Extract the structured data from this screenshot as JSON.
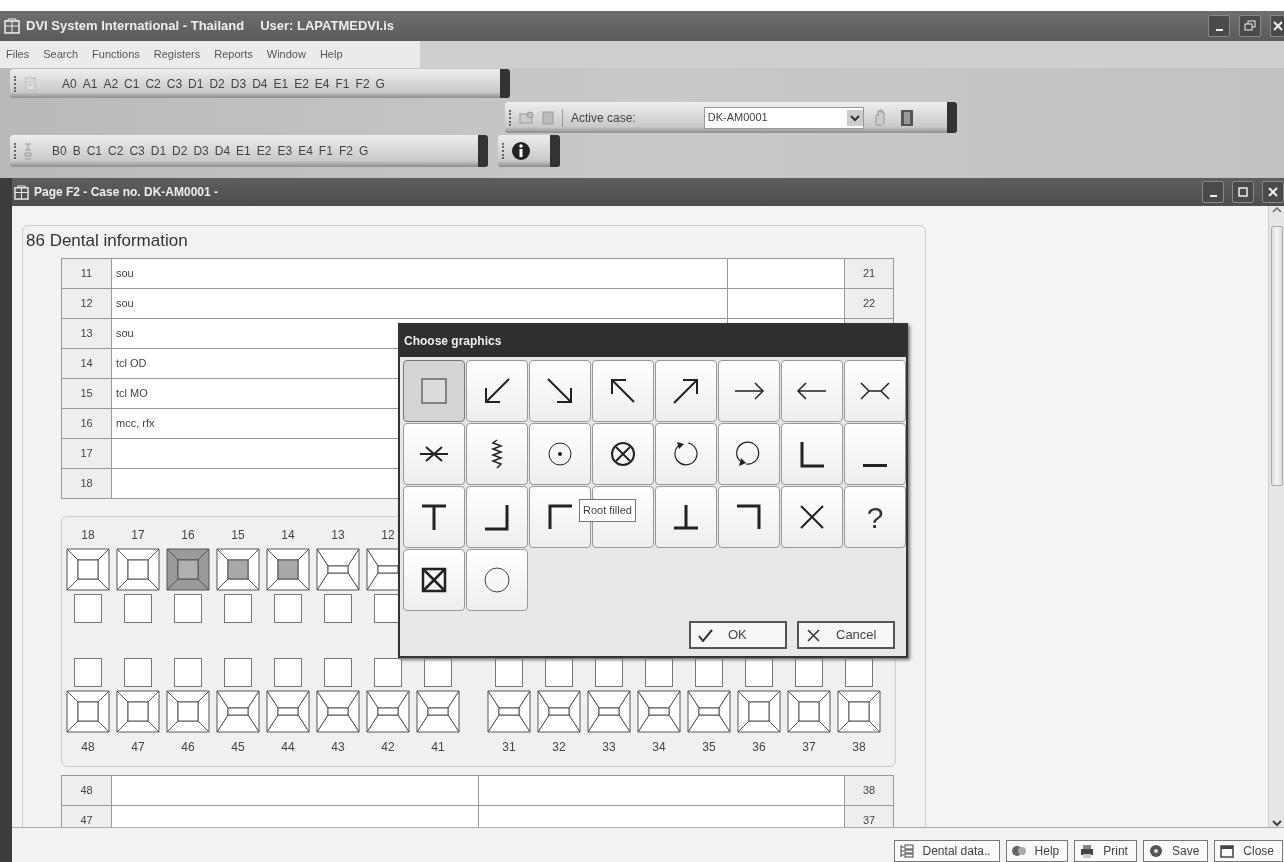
{
  "app": {
    "title": "DVI System International - Thailand",
    "user": "User: LAPATMEDVI.is"
  },
  "menu": [
    {
      "label": "Files"
    },
    {
      "label": "Search"
    },
    {
      "label": "Functions"
    },
    {
      "label": "Registers"
    },
    {
      "label": "Reports"
    },
    {
      "label": "Window"
    },
    {
      "label": "Help"
    }
  ],
  "toolbar_a": {
    "buttons": [
      "A0",
      "A1",
      "A2",
      "C1",
      "C2",
      "C3",
      "D1",
      "D2",
      "D3",
      "D4",
      "E1",
      "E2",
      "E4",
      "F1",
      "F2",
      "G"
    ]
  },
  "case_toolbar": {
    "label": "Active case:",
    "value": "DK-AM0001"
  },
  "toolbar_b": {
    "buttons": [
      "B0",
      "B",
      "C1",
      "C2",
      "C3",
      "D1",
      "D2",
      "D3",
      "D4",
      "E1",
      "E2",
      "E3",
      "E4",
      "F1",
      "F2",
      "G"
    ]
  },
  "page": {
    "title": "Page F2 - Case no. DK-AM0001 -",
    "section": "86 Dental information",
    "upper_table": [
      {
        "tooth": "11",
        "finding": "sou",
        "opposite": "21"
      },
      {
        "tooth": "12",
        "finding": "sou",
        "opposite": "22"
      },
      {
        "tooth": "13",
        "finding": "sou"
      },
      {
        "tooth": "14",
        "finding": "tcl OD"
      },
      {
        "tooth": "15",
        "finding": "tcl MO"
      },
      {
        "tooth": "16",
        "finding": "mcc, rfx"
      },
      {
        "tooth": "17"
      },
      {
        "tooth": "18"
      }
    ],
    "chart": {
      "upper": [
        {
          "number": "18",
          "kind": "molar",
          "filled": false,
          "center_filled": false
        },
        {
          "number": "17",
          "kind": "molar",
          "filled": false,
          "center_filled": false
        },
        {
          "number": "16",
          "kind": "molar",
          "filled": true,
          "center_filled": true
        },
        {
          "number": "15",
          "kind": "molar",
          "filled": false,
          "center_filled": true
        },
        {
          "number": "14",
          "kind": "molar",
          "filled": false,
          "center_filled": true
        },
        {
          "number": "13",
          "kind": "front",
          "filled": false,
          "center_filled": false
        },
        {
          "number": "12",
          "kind": "front",
          "filled": false,
          "center_filled": false
        }
      ],
      "lower": [
        {
          "number": "48",
          "kind": "molar",
          "filled": false,
          "center_filled": false
        },
        {
          "number": "47",
          "kind": "molar",
          "filled": false,
          "center_filled": false
        },
        {
          "number": "46",
          "kind": "molar",
          "filled": false,
          "center_filled": false
        },
        {
          "number": "45",
          "kind": "front",
          "filled": false,
          "center_filled": false
        },
        {
          "number": "44",
          "kind": "front",
          "filled": false,
          "center_filled": false
        },
        {
          "number": "43",
          "kind": "front",
          "filled": false,
          "center_filled": false
        },
        {
          "number": "42",
          "kind": "front",
          "filled": false,
          "center_filled": false
        },
        {
          "number": "41",
          "kind": "front",
          "filled": false,
          "center_filled": false
        },
        {
          "number": "31",
          "kind": "front",
          "filled": false,
          "center_filled": false
        },
        {
          "number": "32",
          "kind": "front",
          "filled": false,
          "center_filled": false
        },
        {
          "number": "33",
          "kind": "front",
          "filled": false,
          "center_filled": false
        },
        {
          "number": "34",
          "kind": "front",
          "filled": false,
          "center_filled": false
        },
        {
          "number": "35",
          "kind": "front",
          "filled": false,
          "center_filled": false
        },
        {
          "number": "36",
          "kind": "molar",
          "filled": false,
          "center_filled": false
        },
        {
          "number": "37",
          "kind": "molar",
          "filled": false,
          "center_filled": false
        },
        {
          "number": "38",
          "kind": "molar",
          "filled": false,
          "center_filled": false
        }
      ]
    },
    "lower_table": [
      {
        "tooth": "48",
        "opposite": "38"
      },
      {
        "tooth": "47",
        "opposite": "37"
      }
    ]
  },
  "dialog": {
    "title": "Choose graphics",
    "tooltip": "Root filled",
    "symbols": [
      {
        "kind": "square",
        "selected": true
      },
      {
        "kind": "arrow-down-left",
        "selected": false
      },
      {
        "kind": "arrow-down-right",
        "selected": false
      },
      {
        "kind": "arrow-up-left",
        "selected": false
      },
      {
        "kind": "arrow-up-right",
        "selected": false
      },
      {
        "kind": "arrow-right",
        "selected": false
      },
      {
        "kind": "arrow-left",
        "selected": false
      },
      {
        "kind": "bracket-lines",
        "selected": false
      },
      {
        "kind": "asterisk-line",
        "selected": false
      },
      {
        "kind": "zigzag",
        "selected": false
      },
      {
        "kind": "dot-circle",
        "selected": false
      },
      {
        "kind": "cross-circle",
        "selected": false
      },
      {
        "kind": "circle-arrow-cw",
        "selected": false
      },
      {
        "kind": "circle-arrow-ccw",
        "selected": false
      },
      {
        "kind": "corner-bottom-left",
        "selected": false
      },
      {
        "kind": "underline",
        "selected": false
      },
      {
        "kind": "tee",
        "selected": false
      },
      {
        "kind": "corner-bottom-right",
        "selected": false
      },
      {
        "kind": "corner-top-left",
        "selected": false
      },
      {
        "kind": "covered",
        "selected": false
      },
      {
        "kind": "up-tack",
        "selected": false
      },
      {
        "kind": "corner-top-right",
        "selected": false
      },
      {
        "kind": "x-mark",
        "selected": false
      },
      {
        "kind": "text",
        "label": "?",
        "selected": false
      },
      {
        "kind": "boxed-x",
        "selected": false
      },
      {
        "kind": "circle",
        "selected": false
      }
    ],
    "buttons": [
      {
        "label": "OK",
        "kind": "ok"
      },
      {
        "label": "Cancel",
        "kind": "cancel"
      }
    ]
  },
  "footer_buttons": [
    {
      "label": "Dental data..",
      "kind": "list"
    },
    {
      "label": "Help",
      "kind": "help"
    },
    {
      "label": "Print",
      "kind": "print"
    },
    {
      "label": "Save",
      "kind": "save"
    },
    {
      "label": "Close",
      "kind": "close"
    }
  ]
}
